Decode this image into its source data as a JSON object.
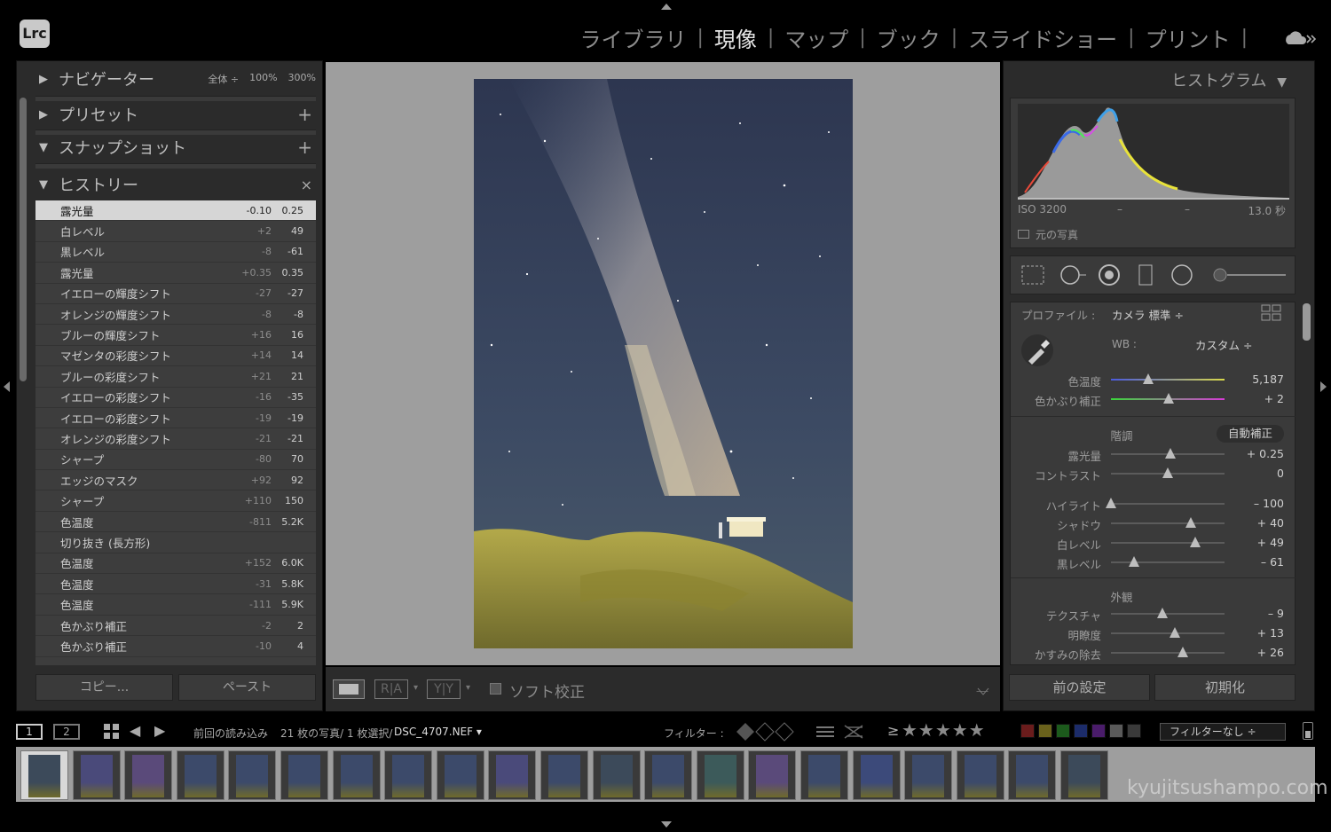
{
  "app": {
    "logo": "Lrc"
  },
  "modules": [
    "ライブラリ",
    "現像",
    "マップ",
    "ブック",
    "スライドショー",
    "プリント"
  ],
  "active_module": "現像",
  "left": {
    "navigator": {
      "label": "ナビゲーター",
      "zoom_options": [
        "全体 ÷",
        "100%",
        "300%"
      ]
    },
    "presets": {
      "label": "プリセット"
    },
    "snapshots": {
      "label": "スナップショット"
    },
    "history": {
      "label": "ヒストリー",
      "items": [
        {
          "name": "露光量",
          "delta": "-0.10",
          "value": "0.25"
        },
        {
          "name": "白レベル",
          "delta": "+2",
          "value": "49"
        },
        {
          "name": "黒レベル",
          "delta": "-8",
          "value": "-61"
        },
        {
          "name": "露光量",
          "delta": "+0.35",
          "value": "0.35"
        },
        {
          "name": "イエローの輝度シフト",
          "delta": "-27",
          "value": "-27"
        },
        {
          "name": "オレンジの輝度シフト",
          "delta": "-8",
          "value": "-8"
        },
        {
          "name": "ブルーの輝度シフト",
          "delta": "+16",
          "value": "16"
        },
        {
          "name": "マゼンタの彩度シフト",
          "delta": "+14",
          "value": "14"
        },
        {
          "name": "ブルーの彩度シフト",
          "delta": "+21",
          "value": "21"
        },
        {
          "name": "イエローの彩度シフト",
          "delta": "-16",
          "value": "-35"
        },
        {
          "name": "イエローの彩度シフト",
          "delta": "-19",
          "value": "-19"
        },
        {
          "name": "オレンジの彩度シフト",
          "delta": "-21",
          "value": "-21"
        },
        {
          "name": "シャープ",
          "delta": "-80",
          "value": "70"
        },
        {
          "name": "エッジのマスク",
          "delta": "+92",
          "value": "92"
        },
        {
          "name": "シャープ",
          "delta": "+110",
          "value": "150"
        },
        {
          "name": "色温度",
          "delta": "-811",
          "value": "5.2K"
        },
        {
          "name": "切り抜き (長方形)",
          "delta": "",
          "value": ""
        },
        {
          "name": "色温度",
          "delta": "+152",
          "value": "6.0K"
        },
        {
          "name": "色温度",
          "delta": "-31",
          "value": "5.8K"
        },
        {
          "name": "色温度",
          "delta": "-111",
          "value": "5.9K"
        },
        {
          "name": "色かぶり補正",
          "delta": "-2",
          "value": "2"
        },
        {
          "name": "色かぶり補正",
          "delta": "-10",
          "value": "4"
        }
      ]
    },
    "copy_button": "コピー...",
    "paste_button": "ペースト"
  },
  "toolbar": {
    "soft_proof": "ソフト校正",
    "ra": "R|A",
    "yy": "Y|Y"
  },
  "right": {
    "histogram": {
      "label": "ヒストグラム",
      "iso": "ISO 3200",
      "dash1": "–",
      "dash2": "–",
      "shutter": "13.0 秒",
      "original_photo": "元の写真"
    },
    "profile": {
      "label": "プロファイル :",
      "value": "カメラ 標準 ÷"
    },
    "wb": {
      "label": "WB :",
      "value": "カスタム ÷"
    },
    "temp": {
      "label": "色温度",
      "value": "5,187",
      "pos": 0.33
    },
    "tint": {
      "label": "色かぶり補正",
      "value": "+ 2",
      "pos": 0.51
    },
    "tone": {
      "label": "階調",
      "auto": "自動補正"
    },
    "exposure": {
      "label": "露光量",
      "value": "+ 0.25",
      "pos": 0.52
    },
    "contrast": {
      "label": "コントラスト",
      "value": "0",
      "pos": 0.5
    },
    "highlights": {
      "label": "ハイライト",
      "value": "– 100",
      "pos": 0.0
    },
    "shadows": {
      "label": "シャドウ",
      "value": "+ 40",
      "pos": 0.7
    },
    "whites": {
      "label": "白レベル",
      "value": "+ 49",
      "pos": 0.74
    },
    "blacks": {
      "label": "黒レベル",
      "value": "– 61",
      "pos": 0.2
    },
    "presence": {
      "label": "外観"
    },
    "texture": {
      "label": "テクスチャ",
      "value": "– 9",
      "pos": 0.45
    },
    "clarity": {
      "label": "明瞭度",
      "value": "+ 13",
      "pos": 0.56
    },
    "dehaze": {
      "label": "かすみの除去",
      "value": "+ 26",
      "pos": 0.63
    },
    "previous_button": "前の設定",
    "reset_button": "初期化"
  },
  "filmbar": {
    "page1": "1",
    "page2": "2",
    "source": "前回の読み込み",
    "count": "21 枚の写真/ 1 枚選択/",
    "filename": "DSC_4707.NEF ▾",
    "filter_label": "フィルター :",
    "rating_op": "≥",
    "stars": "★★★★★",
    "filter_select": "フィルターなし ÷"
  },
  "watermark": "kyujitsushampo.com"
}
